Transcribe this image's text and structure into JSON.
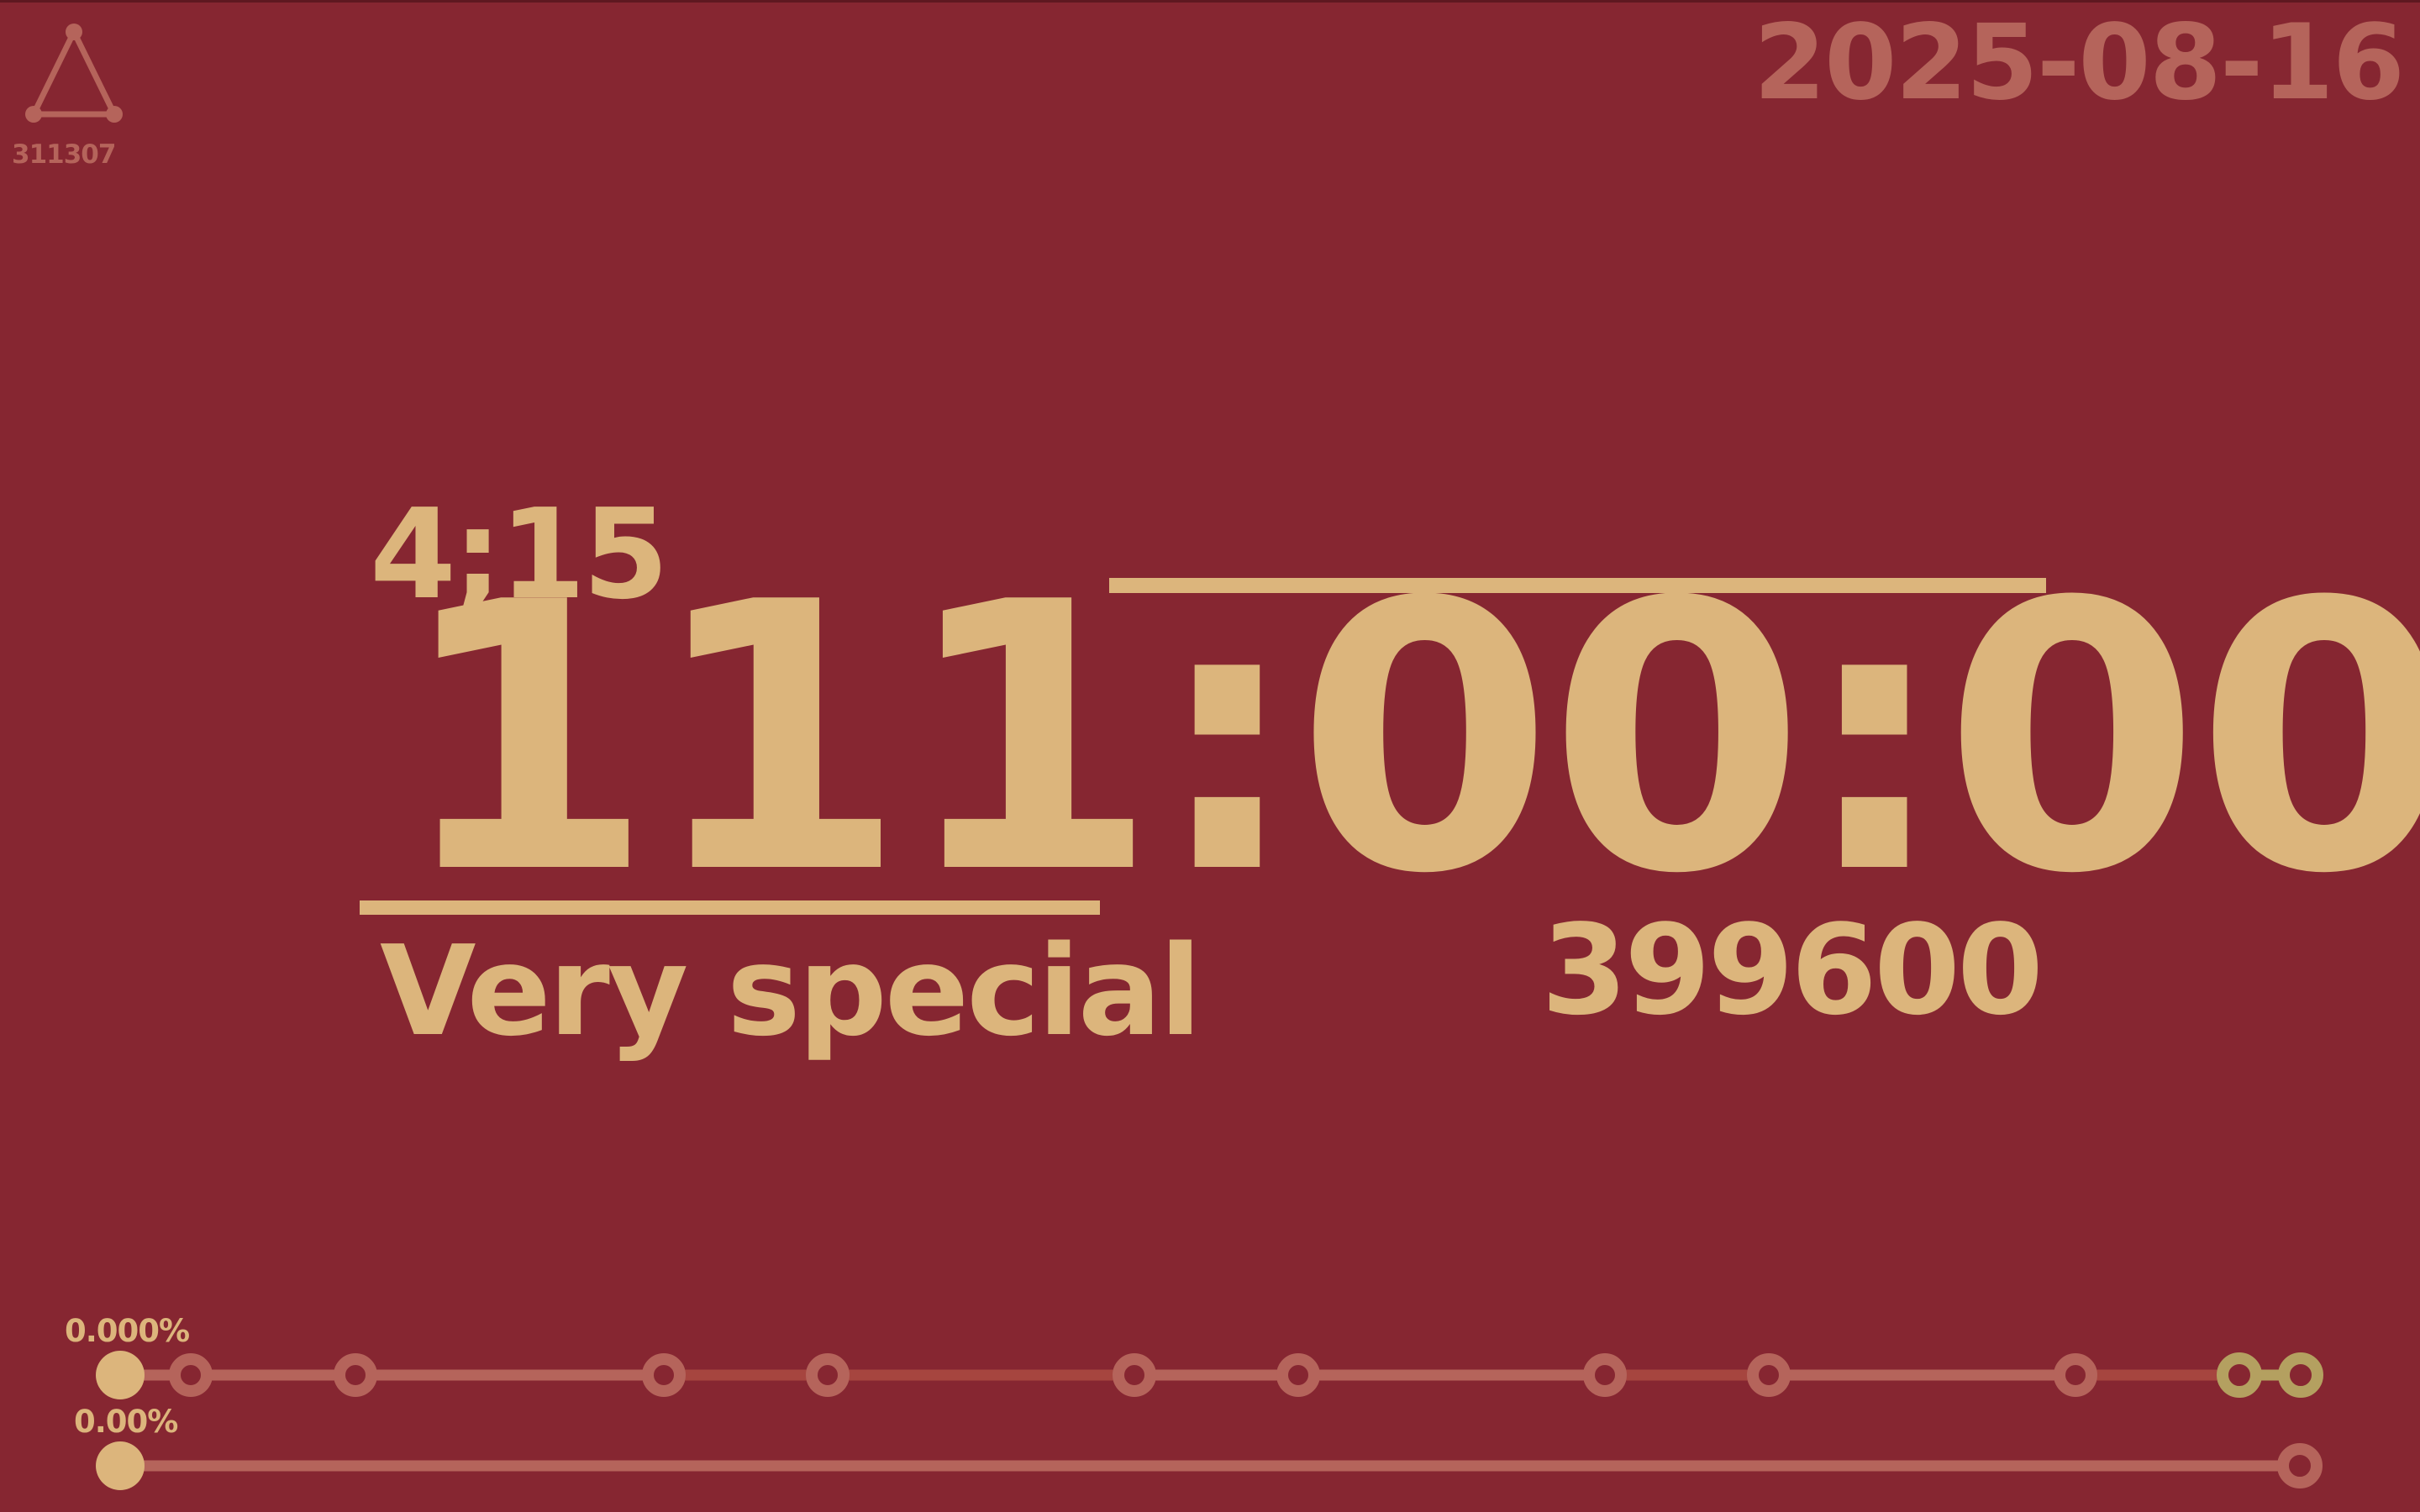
{
  "header": {
    "code": "311307",
    "date": "2025-08-16",
    "logo_icon": "triangle-nodes-icon"
  },
  "clock": {
    "small_time": "4;15",
    "main_time": "111:00:00",
    "label": "Very special",
    "count": "399600"
  },
  "progress": {
    "top": {
      "percent_label": "0.000%",
      "value": 0.0
    },
    "bottom": {
      "percent_label": "0.00%",
      "value": 0.0
    }
  },
  "colors": {
    "background": "#862631",
    "accent": "#dcb57c",
    "muted": "#b5645b",
    "dim": "#a6453f",
    "olive": "#b4a060"
  }
}
